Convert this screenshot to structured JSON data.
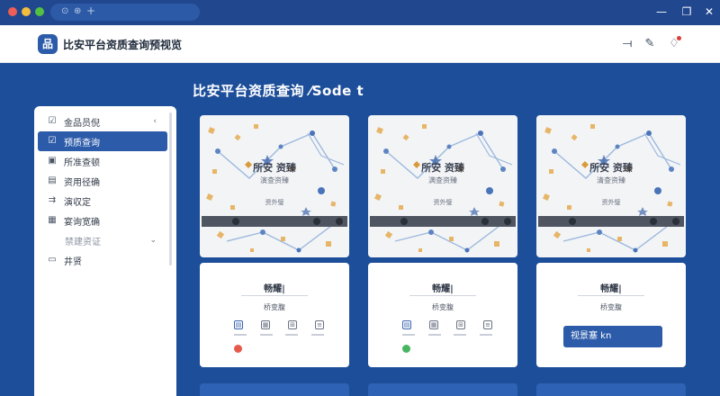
{
  "browser": {
    "tab_icon_1": "⊙",
    "tab_icon_2": "⊕",
    "tab_plus": "+",
    "minimize": "—",
    "restore": "❐",
    "close": "✕"
  },
  "header": {
    "logo": "品",
    "title": "比安平台资质查询预视览",
    "icons": [
      "minus-line-icon",
      "tag-icon",
      "notification-icon"
    ]
  },
  "page": {
    "heading": "比安平台资质查询 ⁄Sode t"
  },
  "sidebar": {
    "items": [
      {
        "label": "金品员倪",
        "icon": "☑",
        "chevron": "‹"
      },
      {
        "label": "预质查询",
        "icon": "☑",
        "active": true
      },
      {
        "label": "所准查顿",
        "icon": "▣"
      },
      {
        "label": "资用径确",
        "icon": "▤"
      },
      {
        "label": "演収定",
        "icon": "⇉"
      },
      {
        "label": "宴询宽确",
        "icon": "▦"
      },
      {
        "label": "禁建资证",
        "chevron": "⌄"
      },
      {
        "label": "井贤",
        "icon": "▭"
      }
    ]
  },
  "cards": [
    {
      "image_title": "所安 资臻",
      "image_sub": "演查资臻",
      "image_tag": "资外璧",
      "info_title": "畅耀|",
      "info_sub": "桥变腹",
      "status_color": "#e65a4c"
    },
    {
      "image_title": "所安 资臻",
      "image_sub": "满查资臻",
      "image_tag": "资外璧",
      "info_title": "畅耀|",
      "info_sub": "桥变腹",
      "status_color": "#48b660"
    },
    {
      "image_title": "所安 资臻",
      "image_sub": "清查资臻",
      "image_tag": "资外璧",
      "info_title": "畅耀|",
      "info_sub": "桥变腹",
      "button_label": "视景塞 kn"
    }
  ],
  "colors": {
    "background": "#1d4e9a",
    "accent": "#2c5ba9"
  }
}
